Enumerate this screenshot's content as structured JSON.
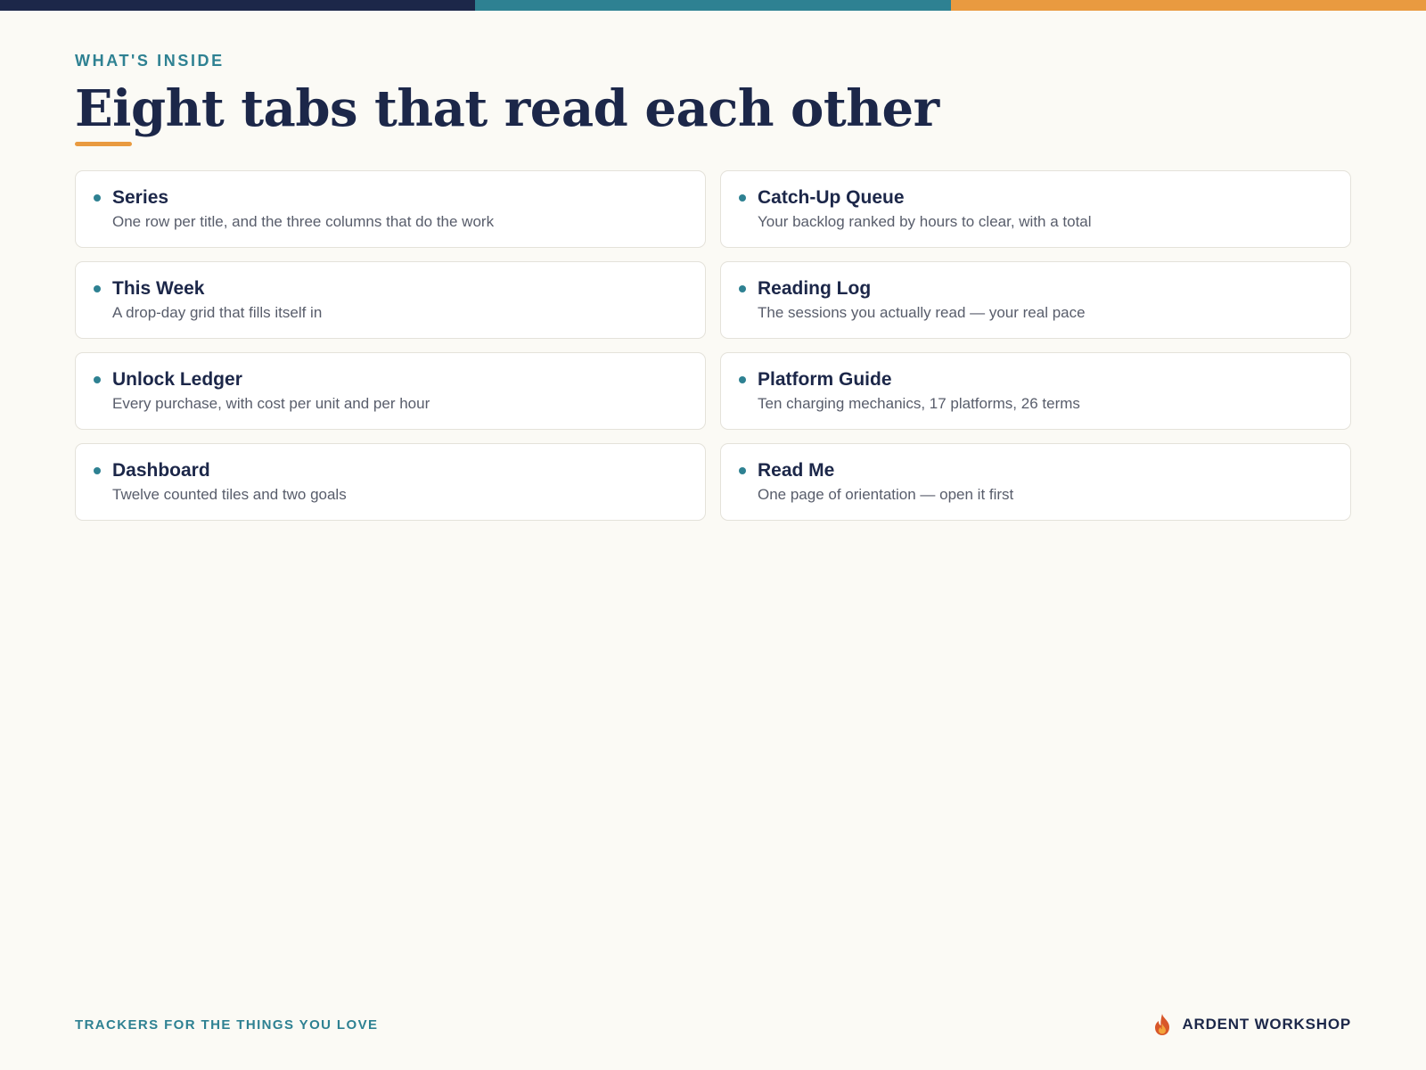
{
  "colors": {
    "navy": "#1c2749",
    "teal": "#2e8192",
    "orange": "#e99a40",
    "background": "#fbfaf5",
    "card_border": "#e4e2da",
    "muted_text": "#585d6b"
  },
  "header": {
    "eyebrow": "WHAT'S INSIDE",
    "title": "Eight tabs that read each other"
  },
  "tabs": [
    {
      "title": "Series",
      "description": "One row per title, and the three columns that do the work"
    },
    {
      "title": "Catch-Up Queue",
      "description": "Your backlog ranked by hours to clear, with a total"
    },
    {
      "title": "This Week",
      "description": "A drop-day grid that fills itself in"
    },
    {
      "title": "Reading Log",
      "description": "The sessions you actually read — your real pace"
    },
    {
      "title": "Unlock Ledger",
      "description": "Every purchase, with cost per unit and per hour"
    },
    {
      "title": "Platform Guide",
      "description": "Ten charging mechanics, 17 platforms, 26 terms"
    },
    {
      "title": "Dashboard",
      "description": "Twelve counted tiles and two goals"
    },
    {
      "title": "Read Me",
      "description": "One page of orientation — open it first"
    }
  ],
  "footer": {
    "tagline": "TRACKERS FOR THE THINGS YOU LOVE",
    "brand_name": "ARDENT WORKSHOP",
    "brand_icon": "flame-icon"
  }
}
